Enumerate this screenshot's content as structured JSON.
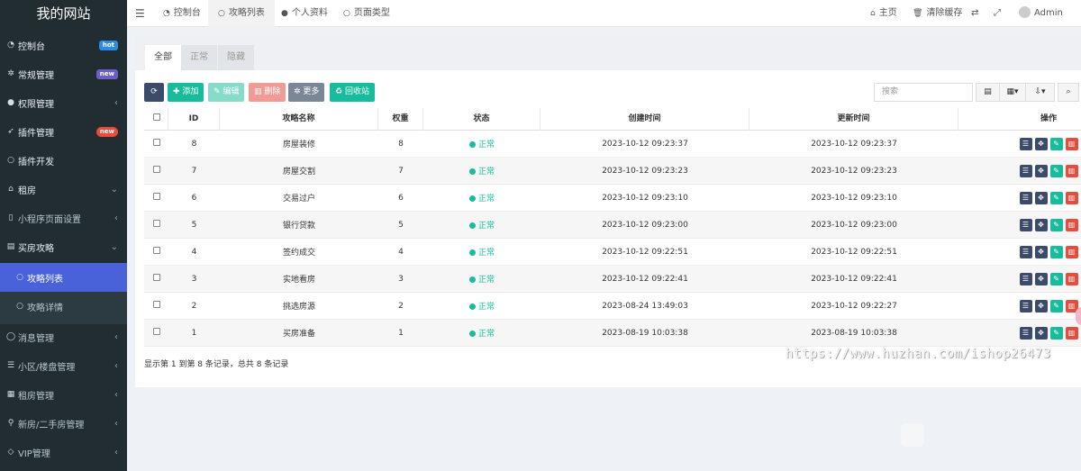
{
  "app": {
    "title": "我的网站"
  },
  "sidebar": {
    "items": [
      {
        "label": "控制台",
        "icon": "dashboard-icon",
        "badge": "hot",
        "badge_color": "#2d8ce0"
      },
      {
        "label": "常规管理",
        "icon": "cogs-icon",
        "badge": "new",
        "badge_color": "#6b5fc7"
      },
      {
        "label": "权限管理",
        "icon": "group-icon",
        "chevron": "‹"
      },
      {
        "label": "插件管理",
        "icon": "rocket-icon",
        "badge": "new",
        "badge_color": "#e74c3c"
      },
      {
        "label": "插件开发",
        "icon": "circle-icon"
      },
      {
        "label": "租房",
        "icon": "home-icon",
        "chevron": "⌄"
      },
      {
        "label": "小程序页面设置",
        "icon": "file-icon",
        "chevron": "‹"
      },
      {
        "label": "买房攻略",
        "icon": "book-icon",
        "chevron": "⌄"
      },
      {
        "label": "攻略列表",
        "icon": "circle-icon"
      },
      {
        "label": "攻略详情",
        "icon": "circle-icon"
      },
      {
        "label": "消息管理",
        "icon": "comment-icon",
        "chevron": "‹"
      },
      {
        "label": "小区/楼盘管理",
        "icon": "list-icon",
        "chevron": "‹"
      },
      {
        "label": "租房管理",
        "icon": "building-icon",
        "chevron": "‹"
      },
      {
        "label": "新房/二手房管理",
        "icon": "map-marker-icon",
        "chevron": "‹"
      },
      {
        "label": "VIP管理",
        "icon": "diamond-icon",
        "chevron": "‹"
      }
    ]
  },
  "topbar": {
    "menu_icon": "☰",
    "tabs": [
      {
        "label": "控制台",
        "icon": "dashboard-icon"
      },
      {
        "label": "攻略列表",
        "icon": "circle-icon"
      },
      {
        "label": "个人资料",
        "icon": "user-icon"
      },
      {
        "label": "页面类型",
        "icon": "circle-icon"
      }
    ],
    "right": {
      "home": "主页",
      "clear_cache": "清除缓存",
      "user": "Admin"
    }
  },
  "content": {
    "tabs": [
      "全部",
      "正常",
      "隐藏"
    ],
    "toolbar": {
      "add": "添加",
      "edit": "编辑",
      "delete": "删除",
      "more": "更多",
      "recycle": "回收站",
      "search_placeholder": "搜索"
    },
    "table": {
      "columns": [
        "ID",
        "攻略名称",
        "权重",
        "状态",
        "创建时间",
        "更新时间",
        "操作"
      ],
      "rows": [
        {
          "id": "8",
          "name": "房屋装修",
          "weight": "8",
          "status": "正常",
          "created": "2023-10-12 09:23:37",
          "updated": "2023-10-12 09:23:37"
        },
        {
          "id": "7",
          "name": "房屋交割",
          "weight": "7",
          "status": "正常",
          "created": "2023-10-12 09:23:23",
          "updated": "2023-10-12 09:23:23"
        },
        {
          "id": "6",
          "name": "交易过户",
          "weight": "6",
          "status": "正常",
          "created": "2023-10-12 09:23:10",
          "updated": "2023-10-12 09:23:10"
        },
        {
          "id": "5",
          "name": "银行贷款",
          "weight": "5",
          "status": "正常",
          "created": "2023-10-12 09:23:00",
          "updated": "2023-10-12 09:23:00"
        },
        {
          "id": "4",
          "name": "签约成交",
          "weight": "4",
          "status": "正常",
          "created": "2023-10-12 09:22:51",
          "updated": "2023-10-12 09:22:51"
        },
        {
          "id": "3",
          "name": "实地看房",
          "weight": "3",
          "status": "正常",
          "created": "2023-10-12 09:22:41",
          "updated": "2023-10-12 09:22:41"
        },
        {
          "id": "2",
          "name": "挑选房源",
          "weight": "2",
          "status": "正常",
          "created": "2023-08-24 13:49:03",
          "updated": "2023-10-12 09:22:27"
        },
        {
          "id": "1",
          "name": "买房准备",
          "weight": "1",
          "status": "正常",
          "created": "2023-08-19 10:03:38",
          "updated": "2023-08-19 10:03:38"
        }
      ]
    },
    "pagination_text": "显示第 1 到第 8 条记录，总共 8 条记录"
  },
  "watermark": "https://www.huzhan.com/ishop26473",
  "colors": {
    "sidebar_bg": "#222d32",
    "active": "#4a62d9",
    "success": "#18bc9c",
    "danger": "#e74c3c"
  }
}
